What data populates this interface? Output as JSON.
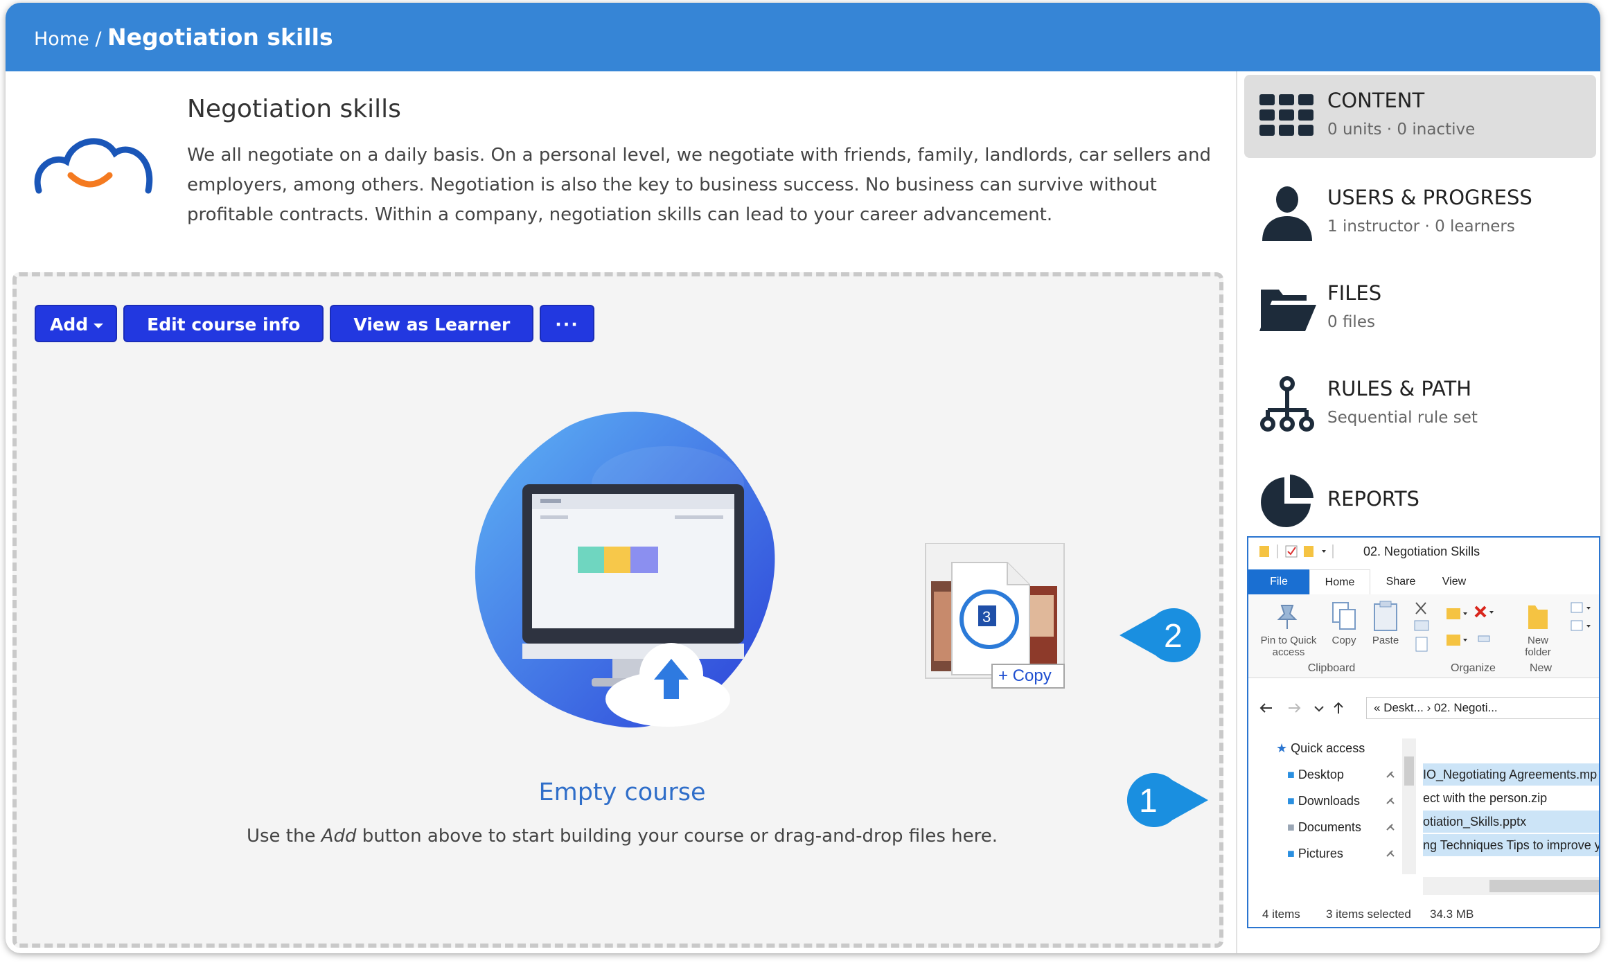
{
  "header": {
    "breadcrumb_home": "Home",
    "breadcrumb_sep": "/",
    "breadcrumb_current": "Negotiation skills"
  },
  "course": {
    "title": "Negotiation skills",
    "description": "We all negotiate on a daily basis. On a personal level, we negotiate with friends, family, landlords, car sellers and employers, among others. Negotiation is also the key to business success. No business can survive without profitable contracts. Within a company, negotiation skills can lead to your career advancement."
  },
  "toolbar": {
    "add_label": "Add",
    "edit_label": "Edit course info",
    "view_label": "View as Learner",
    "more_label": "···"
  },
  "empty": {
    "title": "Empty course",
    "text_before": "Use the",
    "text_em": "Add",
    "text_after": "button above to start building your course or drag-and-drop files here."
  },
  "drag": {
    "copy_label": "+ Copy"
  },
  "callouts": {
    "one": "1",
    "two": "2"
  },
  "sidebar": {
    "items": [
      {
        "title": "CONTENT",
        "subtitle": "0 units · 0 inactive",
        "icon": "grid-icon"
      },
      {
        "title": "USERS & PROGRESS",
        "subtitle": "1 instructor · 0 learners",
        "icon": "user-icon"
      },
      {
        "title": "FILES",
        "subtitle": "0 files",
        "icon": "folder-icon"
      },
      {
        "title": "RULES & PATH",
        "subtitle": "Sequential rule set",
        "icon": "hierarchy-icon"
      },
      {
        "title": "REPORTS",
        "subtitle": "",
        "icon": "pie-chart-icon"
      }
    ]
  },
  "explorer": {
    "title": "02. Negotiation Skills",
    "tabs": {
      "file": "File",
      "home": "Home",
      "share": "Share",
      "view": "View"
    },
    "ribbon": {
      "pin_line1": "Pin to Quick",
      "pin_line2": "access",
      "copy": "Copy",
      "paste": "Paste",
      "new_folder_line1": "New",
      "new_folder_line2": "folder",
      "group_clipboard": "Clipboard",
      "group_organize": "Organize",
      "group_new": "New"
    },
    "address": {
      "prefix": "«",
      "part1": "Deskt...",
      "sep": "›",
      "part2": "02. Negoti..."
    },
    "tree": [
      "Quick access",
      "Desktop",
      "Downloads",
      "Documents",
      "Pictures"
    ],
    "files": [
      "IO_Negotiating Agreements.mp",
      "ect with the person.zip",
      "otiation_Skills.pptx",
      "ng Techniques Tips to improve y"
    ],
    "status": {
      "items": "4 items",
      "selected": "3 items selected",
      "size": "34.3 MB"
    }
  }
}
